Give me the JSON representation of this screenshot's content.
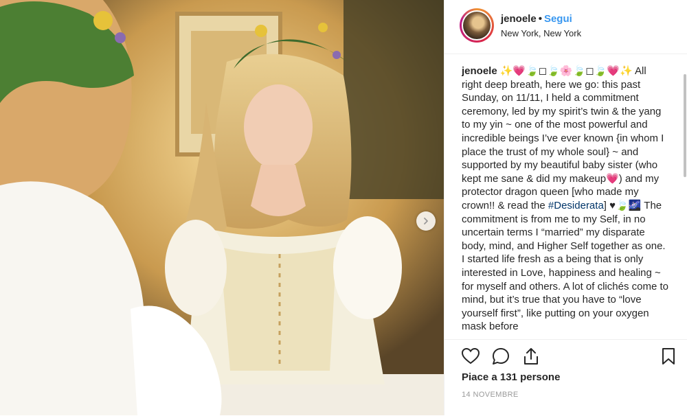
{
  "post": {
    "username": "jenoele",
    "separator": "•",
    "follow_label": "Segui",
    "location": "New York, New York",
    "caption_user": "jenoele",
    "caption_emoji_header": "✨💗🍃◻🍃🌸🍃◻🍃💗✨",
    "caption_part1": "All right deep breath, here we go: this past Sunday, on 11/11, I held a commitment ceremony, led by my spirit’s twin & the yang to my yin ~ one of the most powerful and incredible beings I’ve ever known {in whom I place the trust of my whole soul} ~ and supported by my beautiful baby sister (who kept me sane & did my makeup💗) and my protector dragon queen [who made my crown!! & read the ",
    "hashtag": "#Desiderata",
    "caption_part2": "] ♥🍃🌌 The commitment is from me to my Self, in no uncertain terms I “married” my disparate body, mind, and Higher Self together as one. I started life fresh as a being that is only interested in Love, happiness and healing ~ for myself and others. A lot of clichés come to mind, but it’s true that you have to “love yourself first”, like putting on your oxygen mask before",
    "likes_text": "Piace a 131 persone",
    "date": "14 NOVEMBRE"
  },
  "icons": {
    "like": "heart-icon",
    "comment": "comment-icon",
    "share": "share-icon",
    "save": "bookmark-icon",
    "next": "chevron-right-icon"
  },
  "colors": {
    "link_blue": "#3897f0",
    "hashtag": "#003569",
    "text": "#262626",
    "muted": "#999999"
  }
}
